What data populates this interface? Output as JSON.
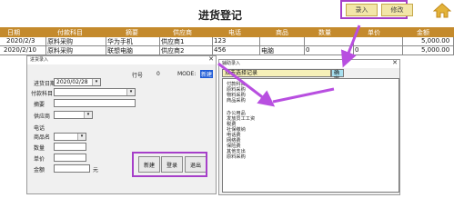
{
  "header": {
    "title": "进货登记",
    "buttons": [
      "录入",
      "修改"
    ],
    "home_icon": "home-icon"
  },
  "table": {
    "columns": [
      "日期",
      "付款科目",
      "摘要",
      "供应商",
      "电话",
      "商品",
      "数量",
      "单价",
      "金额"
    ],
    "rows": [
      [
        "2020/2/3",
        "原料采购",
        "华为手机",
        "供应商1",
        "123",
        "",
        "",
        "",
        "5,000.00"
      ],
      [
        "2020/2/10",
        "原料采购",
        "联想电脑",
        "供应商2",
        "456",
        "电脑",
        "0",
        "0",
        "5,000.00"
      ]
    ]
  },
  "form_dialog": {
    "title": "进货录入",
    "row_label": "行号",
    "row_value": "0",
    "mode_label": "MODE:",
    "mode_value": "新建",
    "fields": {
      "date_label": "进货日期",
      "date_value": "2020/02/28",
      "account_label": "付款科目",
      "summary_label": "摘要",
      "supplier_label": "供应商",
      "phone_label": "电话",
      "product_label": "商品名",
      "qty_label": "数量",
      "price_label": "单价",
      "amount_label": "金额",
      "amount_unit": "元"
    },
    "buttons": [
      "新建",
      "登录",
      "退出"
    ]
  },
  "assist_dialog": {
    "title": "辅助录入",
    "search_placeholder": "双击选择记录",
    "confirm_button": "确定",
    "items": [
      "付款科目",
      "原料采购",
      "物料采购",
      "商品采购",
      "",
      "",
      "",
      "",
      "办公用品",
      "发放员工工资",
      "税费",
      "社保缴纳",
      "电话费",
      "网络费",
      "保险费",
      "其他支出",
      "原料采购"
    ]
  },
  "colors": {
    "header_bg": "#c48a2c",
    "button_bg": "#f2e6a8",
    "highlight": "#a63fc9",
    "selection": "#1e5bd6"
  }
}
